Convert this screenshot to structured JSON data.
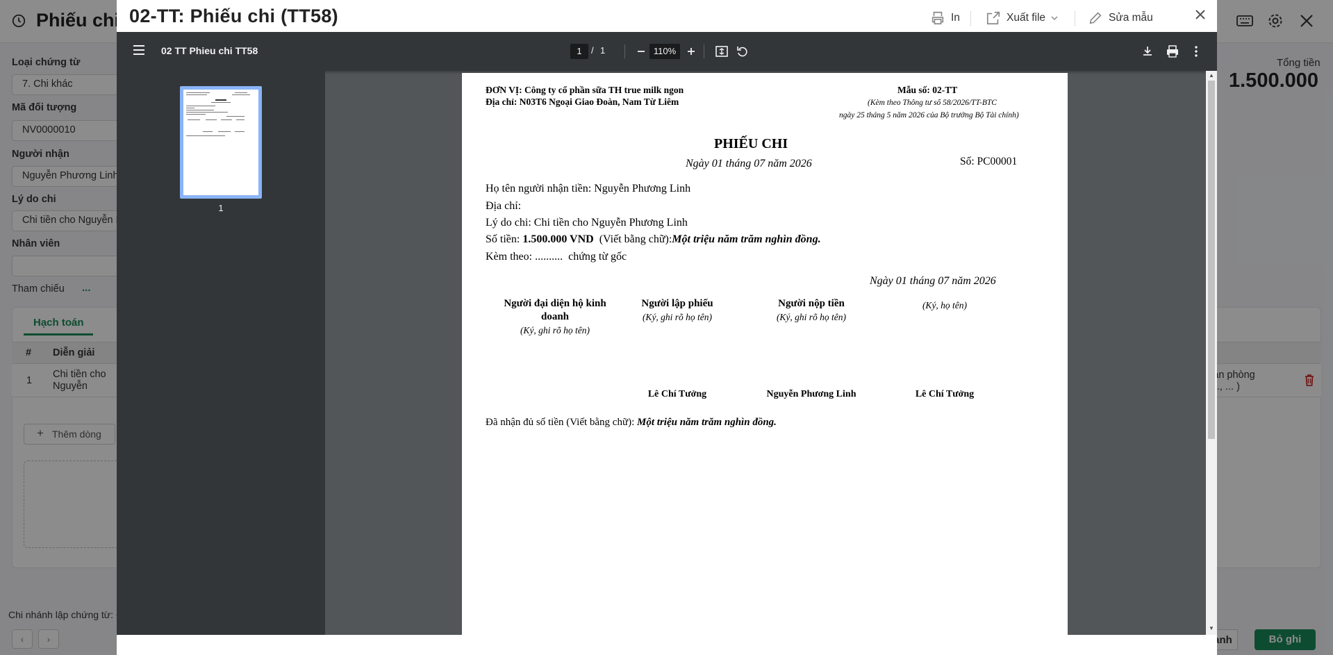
{
  "background": {
    "title": "Phiếu chi",
    "fields": [
      {
        "label": "Loại chứng từ",
        "value": "7. Chi khác"
      },
      {
        "label": "Mã đối tượng",
        "value": "NV0000010"
      },
      {
        "label": "Người nhận",
        "value": "Nguyễn Phương Linh"
      },
      {
        "label": "Lý do chi",
        "value": "Chi tiền cho Nguyễn Phương Linh"
      },
      {
        "label": "Nhân viên",
        "value": ""
      }
    ],
    "reference_label": "Tham chiếu",
    "reference_dots": "...",
    "tab_label": "Hạch toán",
    "table_headers": [
      "#",
      "Diễn giải"
    ],
    "table_row": {
      "index": "1",
      "description": "Chi tiền cho Nguyễn Phương Linh",
      "account_text": "văn phòng\n(..., ... )"
    },
    "add_row_label": "Thêm dòng",
    "total_label": "Tổng tiền",
    "total_value": "1.500.000",
    "branch_label": "Chi nhánh lập chứng từ: C",
    "cancel_label": "Hủy bỏ thanh",
    "save_label": "Bỏ ghi"
  },
  "modal": {
    "title": "02-TT: Phiếu chi (TT58)",
    "print_label": "In",
    "export_label": "Xuất file",
    "edit_template_label": "Sửa mẫu"
  },
  "viewer": {
    "filename": "02 TT Phieu chi TT58",
    "page_current": "1",
    "page_separator": "/",
    "page_total": "1",
    "zoom": "110%",
    "thumbnail_label": "1"
  },
  "document": {
    "unit_line": "ĐƠN VỊ: Công ty cổ phần sữa TH true milk ngon",
    "address_line": "Địa chỉ: N03T6 Ngoại Giao Đoàn, Nam Từ Liêm",
    "form_no": "Mẫu số: 02-TT",
    "form_note1": "(Kèm theo Thông tư số 58/2026/TT-BTC",
    "form_note2": "ngày 25 tháng 5 năm 2026 của Bộ trưởng Bộ Tài chính)",
    "title": "PHIẾU CHI",
    "date": "Ngày 01 tháng 07 năm 2026",
    "number": "Số: PC00001",
    "recipient": "Họ tên người nhận tiền: Nguyễn Phương Linh",
    "address": "Địa chỉ:",
    "reason": "Lý do chi: Chi tiền cho Nguyễn Phương Linh",
    "amount_prefix": "Số tiền: ",
    "amount_value": "1.500.000 VND",
    "amount_words_label": "  (Viết bằng chữ):",
    "amount_words": "Một triệu năm trăm nghìn đồng.",
    "attached": "Kèm theo: ..........  chứng từ gốc",
    "sign_date": "Ngày 01 tháng 07 năm 2026",
    "signers": [
      {
        "role_line1": "Người đại diện hộ kinh",
        "role_line2": "doanh",
        "note": "(Ký, ghi rõ họ tên)",
        "name": ""
      },
      {
        "role_line1": "Người lập phiếu",
        "role_line2": "",
        "note": "(Ký, ghi rõ họ tên)",
        "name": "Lê Chí Tưởng"
      },
      {
        "role_line1": "Người nộp tiền",
        "role_line2": "",
        "note": "(Ký, ghi rõ họ tên)",
        "name": "Nguyễn Phương Linh"
      },
      {
        "role_line1": "",
        "role_line2": "",
        "note": "(Ký, họ tên)",
        "name": "Lê Chí Tưởng"
      }
    ],
    "received_label": "Đã nhận đủ số tiền (Viết bằng chữ): ",
    "received_words": "Một triệu năm trăm nghìn đồng."
  },
  "colors": {
    "accent": "#1a8a5a",
    "delete": "#d32f2f",
    "viewer_toolbar": "#323639",
    "viewer_bg": "#525659",
    "thumb_border": "#8ab4f8"
  }
}
